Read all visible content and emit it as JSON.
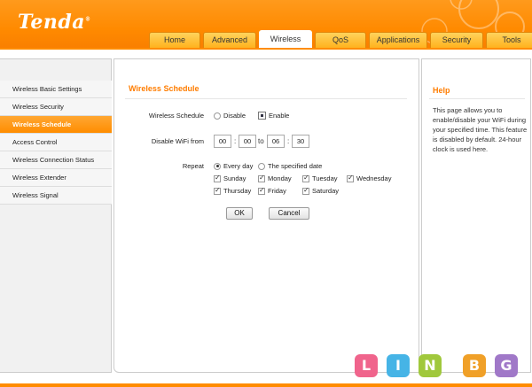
{
  "brand": {
    "logo": "Tenda",
    "logo_mark": "®"
  },
  "tabs": [
    {
      "label": "Home"
    },
    {
      "label": "Advanced"
    },
    {
      "label": "Wireless",
      "active": true
    },
    {
      "label": "QoS"
    },
    {
      "label": "Applications"
    },
    {
      "label": "Security"
    },
    {
      "label": "Tools"
    }
  ],
  "sidebar": {
    "items": [
      {
        "label": "Wireless Basic Settings"
      },
      {
        "label": "Wireless Security"
      },
      {
        "label": "Wireless Schedule",
        "active": true
      },
      {
        "label": "Access Control"
      },
      {
        "label": "Wireless Connection Status"
      },
      {
        "label": "Wireless Extender"
      },
      {
        "label": "Wireless Signal"
      }
    ]
  },
  "main": {
    "title": "Wireless Schedule",
    "schedule": {
      "label": "Wireless Schedule",
      "options": [
        "Disable",
        "Enable"
      ],
      "selected": "Enable"
    },
    "disable_time": {
      "label": "Disable WiFi from",
      "from_hour": "00",
      "from_min": "00",
      "to_label": "to",
      "to_hour": "06",
      "to_min": "30",
      "colon": ":"
    },
    "repeat": {
      "label": "Repeat",
      "options": [
        "Every day",
        "The specified date"
      ],
      "selected": "Every day",
      "days": [
        "Sunday",
        "Monday",
        "Tuesday",
        "Wednesday",
        "Thursday",
        "Friday",
        "Saturday"
      ]
    },
    "buttons": {
      "ok": "OK",
      "cancel": "Cancel"
    }
  },
  "help": {
    "title": "Help",
    "text": "This page allows you to enable/disable your WiFi during your specified time. This feature is disabled by default. 24-hour clock is used here."
  },
  "watermark": {
    "letters": [
      "L",
      "I",
      "N",
      "B",
      "G"
    ],
    "colors": [
      "#f0648c",
      "#46b4e6",
      "#a0c83c",
      "#f0a028",
      "#a078c8"
    ]
  },
  "colors": {
    "accent": "#ff8c00",
    "title": "#ff7d00"
  }
}
